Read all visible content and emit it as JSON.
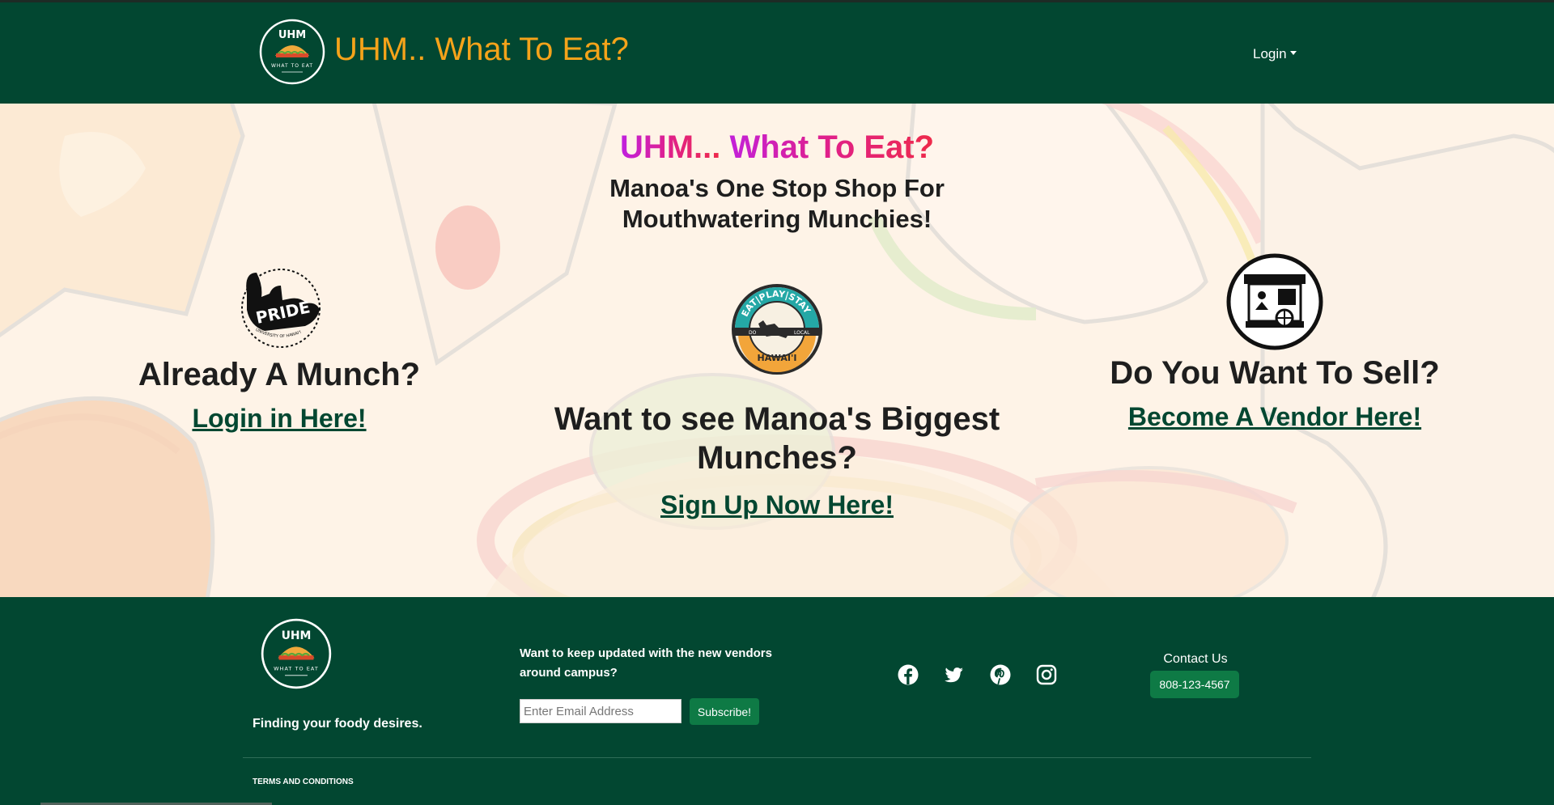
{
  "navbar": {
    "logo": {
      "top_text": "UHM",
      "bottom_text": "WHAT TO EAT"
    },
    "title": "UHM.. What To Eat?",
    "login_label": "Login"
  },
  "hero": {
    "heading_part1": "UHM...",
    "heading_part2": " What To Eat?",
    "subheading": "Manoa's One Stop Shop For Mouthwatering Munchies!",
    "columns": {
      "left": {
        "icon": "shaka-pride-icon",
        "badge_top": "PRIDE",
        "badge_sub": "UNIVERSITY OF HAWAI'I",
        "title": "Already A Munch?",
        "link": "Login in Here!"
      },
      "middle": {
        "icon": "eat-play-stay-badge-icon",
        "badge_top": "EAT|PLAY|STAY",
        "badge_left": "DO",
        "badge_right": "LOCAL",
        "badge_bottom": "HAWAI'I",
        "title": "Want to see Manoa's Biggest Munches?",
        "link": "Sign Up Now Here!"
      },
      "right": {
        "icon": "vendor-stand-icon",
        "title": "Do You Want To Sell?",
        "link": "Become A Vendor Here!"
      }
    }
  },
  "footer": {
    "logo": {
      "top_text": "UHM",
      "bottom_text": "WHAT TO EAT"
    },
    "tagline": "Finding your foody desires.",
    "newsletter_prompt": "Want to keep updated with the new vendors around campus?",
    "email_placeholder": "Enter Email Address",
    "subscribe_label": "Subscribe!",
    "social": [
      "facebook-icon",
      "twitter-icon",
      "pinterest-icon",
      "instagram-icon"
    ],
    "contact_label": "Contact Us",
    "phone": "808-123-4567",
    "terms": "TERMS AND CONDITIONS"
  },
  "colors": {
    "brand_green": "#024731",
    "accent_orange": "#f5a31a",
    "button_green": "#0e7a45",
    "hero_bg": "#fdf1e4"
  }
}
